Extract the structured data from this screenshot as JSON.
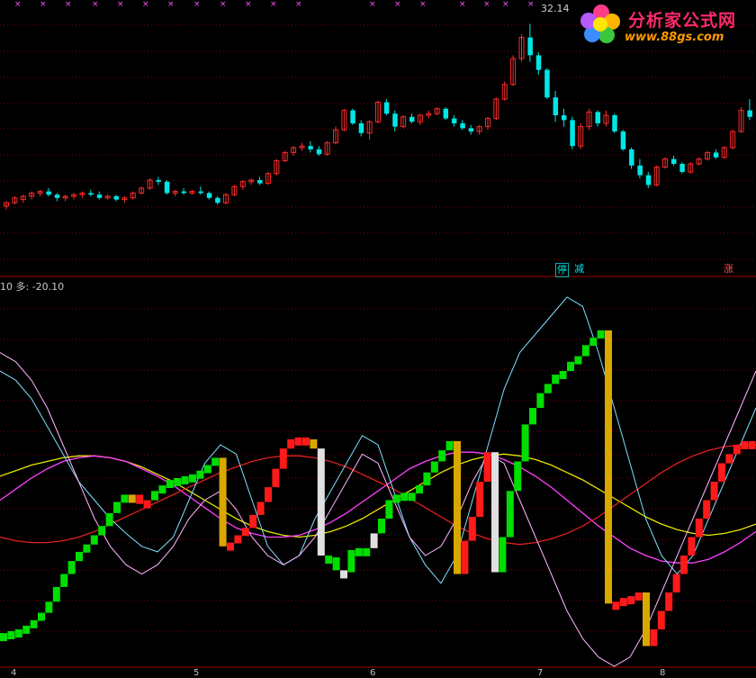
{
  "logo": {
    "title": "分析家公式网",
    "url": "www.88gs.com"
  },
  "price_panel": {
    "high_label": "32.14"
  },
  "indicator_panel": {
    "label": "10 多: -20.10"
  },
  "signals": {
    "stop": "停",
    "cut": "减",
    "up": "涨"
  },
  "date_ticks": [
    "4",
    "5",
    "6",
    "7",
    "8"
  ],
  "colors": {
    "up": "#ff2a2a",
    "down": "#00e6e6",
    "bull_block": "#00dd00",
    "bear_block": "#ff1a1a",
    "grid": "#7a0000",
    "yellow": "#e6e600",
    "magenta": "#ff40ff",
    "red_line": "#e02020",
    "cyan_line": "#7fe0ff",
    "pink_line": "#ffb6ff"
  },
  "chart_data": [
    {
      "type": "candlestick",
      "title": "",
      "candles": [
        [
          20.9,
          21.2,
          20.7,
          21.1
        ],
        [
          21.1,
          21.5,
          21.0,
          21.4
        ],
        [
          21.3,
          21.6,
          21.1,
          21.5
        ],
        [
          21.5,
          21.8,
          21.3,
          21.7
        ],
        [
          21.7,
          21.9,
          21.5,
          21.8
        ],
        [
          21.8,
          22.0,
          21.5,
          21.6
        ],
        [
          21.6,
          21.7,
          21.2,
          21.4
        ],
        [
          21.4,
          21.6,
          21.2,
          21.5
        ],
        [
          21.5,
          21.7,
          21.3,
          21.6
        ],
        [
          21.6,
          21.8,
          21.4,
          21.7
        ],
        [
          21.7,
          21.9,
          21.5,
          21.6
        ],
        [
          21.6,
          21.8,
          21.3,
          21.4
        ],
        [
          21.4,
          21.6,
          21.3,
          21.5
        ],
        [
          21.5,
          21.6,
          21.2,
          21.3
        ],
        [
          21.3,
          21.5,
          21.1,
          21.4
        ],
        [
          21.4,
          21.8,
          21.3,
          21.7
        ],
        [
          21.7,
          22.1,
          21.6,
          22.0
        ],
        [
          22.0,
          22.6,
          21.9,
          22.5
        ],
        [
          22.5,
          22.7,
          22.2,
          22.4
        ],
        [
          22.4,
          22.5,
          21.6,
          21.7
        ],
        [
          21.7,
          21.9,
          21.5,
          21.8
        ],
        [
          21.8,
          22.0,
          21.6,
          21.7
        ],
        [
          21.7,
          21.9,
          21.6,
          21.8
        ],
        [
          21.8,
          22.1,
          21.6,
          21.7
        ],
        [
          21.7,
          21.8,
          21.3,
          21.4
        ],
        [
          21.4,
          21.5,
          21.0,
          21.1
        ],
        [
          21.1,
          21.7,
          21.0,
          21.6
        ],
        [
          21.6,
          22.2,
          21.5,
          22.1
        ],
        [
          22.1,
          22.5,
          21.9,
          22.4
        ],
        [
          22.4,
          22.6,
          22.2,
          22.5
        ],
        [
          22.5,
          22.7,
          22.2,
          22.3
        ],
        [
          22.3,
          23.0,
          22.2,
          22.9
        ],
        [
          22.9,
          23.8,
          22.8,
          23.7
        ],
        [
          23.7,
          24.3,
          23.6,
          24.2
        ],
        [
          24.2,
          24.6,
          24.0,
          24.5
        ],
        [
          24.5,
          24.8,
          24.3,
          24.6
        ],
        [
          24.6,
          24.9,
          24.2,
          24.4
        ],
        [
          24.4,
          24.6,
          24.0,
          24.1
        ],
        [
          24.1,
          24.9,
          24.0,
          24.8
        ],
        [
          24.8,
          25.8,
          24.7,
          25.6
        ],
        [
          25.6,
          26.9,
          25.5,
          26.8
        ],
        [
          26.8,
          26.9,
          25.9,
          26.0
        ],
        [
          26.0,
          26.2,
          25.2,
          25.4
        ],
        [
          25.4,
          26.2,
          25.0,
          26.1
        ],
        [
          26.1,
          27.4,
          26.0,
          27.3
        ],
        [
          27.3,
          27.5,
          26.5,
          26.6
        ],
        [
          26.6,
          26.8,
          25.5,
          25.8
        ],
        [
          25.8,
          26.5,
          25.7,
          26.4
        ],
        [
          26.4,
          26.6,
          26.0,
          26.1
        ],
        [
          26.1,
          26.6,
          25.9,
          26.5
        ],
        [
          26.5,
          26.8,
          26.3,
          26.6
        ],
        [
          26.6,
          27.0,
          26.5,
          26.9
        ],
        [
          26.9,
          27.0,
          26.2,
          26.3
        ],
        [
          26.3,
          26.5,
          25.8,
          26.0
        ],
        [
          26.0,
          26.2,
          25.6,
          25.7
        ],
        [
          25.7,
          25.9,
          25.3,
          25.5
        ],
        [
          25.5,
          25.9,
          25.3,
          25.8
        ],
        [
          25.8,
          26.4,
          25.6,
          26.3
        ],
        [
          26.3,
          27.6,
          26.2,
          27.5
        ],
        [
          27.5,
          28.6,
          27.4,
          28.4
        ],
        [
          28.4,
          30.2,
          28.3,
          30.0
        ],
        [
          30.0,
          31.5,
          29.8,
          31.3
        ],
        [
          31.3,
          32.14,
          29.8,
          30.2
        ],
        [
          30.2,
          30.4,
          29.0,
          29.3
        ],
        [
          29.3,
          29.4,
          27.5,
          27.6
        ],
        [
          27.6,
          28.0,
          26.1,
          26.5
        ],
        [
          26.5,
          26.9,
          25.8,
          26.2
        ],
        [
          26.2,
          26.4,
          24.4,
          24.6
        ],
        [
          24.6,
          26.0,
          24.4,
          25.8
        ],
        [
          25.8,
          26.9,
          25.6,
          26.7
        ],
        [
          26.7,
          26.8,
          25.8,
          26.0
        ],
        [
          26.0,
          26.8,
          25.8,
          26.5
        ],
        [
          26.5,
          26.6,
          25.4,
          25.5
        ],
        [
          25.5,
          25.6,
          24.3,
          24.4
        ],
        [
          24.4,
          24.5,
          23.2,
          23.4
        ],
        [
          23.4,
          23.8,
          22.6,
          22.8
        ],
        [
          22.8,
          23.0,
          22.0,
          22.2
        ],
        [
          22.2,
          23.4,
          22.1,
          23.3
        ],
        [
          23.3,
          23.9,
          23.2,
          23.8
        ],
        [
          23.8,
          24.0,
          23.4,
          23.5
        ],
        [
          23.5,
          23.6,
          22.9,
          23.0
        ],
        [
          23.0,
          23.6,
          22.9,
          23.5
        ],
        [
          23.5,
          23.9,
          23.4,
          23.8
        ],
        [
          23.8,
          24.3,
          23.7,
          24.2
        ],
        [
          24.2,
          24.4,
          23.8,
          23.9
        ],
        [
          23.9,
          24.6,
          23.8,
          24.5
        ],
        [
          24.5,
          25.6,
          24.4,
          25.5
        ],
        [
          25.5,
          27.0,
          25.4,
          26.8
        ],
        [
          26.8,
          27.5,
          26.2,
          26.4
        ]
      ],
      "high_marker": 32.14,
      "signals": [
        {
          "label": "停",
          "index": 76
        },
        {
          "label": "减",
          "index": 78
        },
        {
          "label": "涨",
          "index": 98
        }
      ]
    },
    {
      "type": "line",
      "title": "",
      "value_label": "10 多: -20.10",
      "x_ticks": [
        "4",
        "5",
        "6",
        "7",
        "8"
      ],
      "blocks": [
        [
          -82,
          "g"
        ],
        [
          -81,
          "g"
        ],
        [
          -80,
          "g"
        ],
        [
          -78,
          "g"
        ],
        [
          -75,
          "g"
        ],
        [
          -71,
          "g"
        ],
        [
          -65,
          "g"
        ],
        [
          -57,
          "g"
        ],
        [
          -50,
          "g"
        ],
        [
          -43,
          "g"
        ],
        [
          -38,
          "g"
        ],
        [
          -34,
          "g"
        ],
        [
          -29,
          "g"
        ],
        [
          -24,
          "g"
        ],
        [
          -17,
          "g"
        ],
        [
          -11,
          "g"
        ],
        [
          -7,
          "g"
        ],
        [
          -7,
          "y"
        ],
        [
          -12,
          "r"
        ],
        [
          -10,
          "r"
        ],
        [
          -5,
          "g"
        ],
        [
          -2,
          "g"
        ],
        [
          1,
          "g"
        ],
        [
          2,
          "g"
        ],
        [
          3,
          "g"
        ],
        [
          4,
          "g"
        ],
        [
          6,
          "g"
        ],
        [
          9,
          "g"
        ],
        [
          13,
          "g"
        ],
        [
          -35,
          "y"
        ],
        [
          -33,
          "r"
        ],
        [
          -29,
          "r"
        ],
        [
          -25,
          "r"
        ],
        [
          -18,
          "r"
        ],
        [
          -11,
          "r"
        ],
        [
          -3,
          "r"
        ],
        [
          7,
          "r"
        ],
        [
          18,
          "r"
        ],
        [
          23,
          "r"
        ],
        [
          24,
          "r"
        ],
        [
          23,
          "r"
        ],
        [
          18,
          "y"
        ],
        [
          -40,
          "w"
        ],
        [
          -41,
          "g"
        ],
        [
          -48,
          "g"
        ],
        [
          -49,
          "w"
        ],
        [
          -37,
          "g"
        ],
        [
          -36,
          "g"
        ],
        [
          -36,
          "g"
        ],
        [
          -28,
          "w"
        ],
        [
          -20,
          "g"
        ],
        [
          -10,
          "g"
        ],
        [
          -7,
          "g"
        ],
        [
          -6,
          "g"
        ],
        [
          -6,
          "g"
        ],
        [
          -2,
          "g"
        ],
        [
          5,
          "g"
        ],
        [
          11,
          "g"
        ],
        [
          17,
          "g"
        ],
        [
          22,
          "g"
        ],
        [
          -50,
          "y"
        ],
        [
          -32,
          "r"
        ],
        [
          -19,
          "r"
        ],
        [
          0,
          "r"
        ],
        [
          16,
          "r"
        ],
        [
          -49,
          "w"
        ],
        [
          -30,
          "g"
        ],
        [
          -5,
          "g"
        ],
        [
          11,
          "g"
        ],
        [
          31,
          "g"
        ],
        [
          40,
          "g"
        ],
        [
          48,
          "g"
        ],
        [
          53,
          "g"
        ],
        [
          58,
          "g"
        ],
        [
          60,
          "g"
        ],
        [
          65,
          "g"
        ],
        [
          68,
          "g"
        ],
        [
          74,
          "g"
        ],
        [
          78,
          "g"
        ],
        [
          82,
          "g"
        ],
        [
          -66,
          "y"
        ],
        [
          -65,
          "r"
        ],
        [
          -63,
          "r"
        ],
        [
          -62,
          "r"
        ],
        [
          -60,
          "r"
        ],
        [
          -89,
          "y"
        ],
        [
          -80,
          "r"
        ],
        [
          -70,
          "r"
        ],
        [
          -60,
          "r"
        ],
        [
          -50,
          "r"
        ],
        [
          -40,
          "r"
        ],
        [
          -30,
          "r"
        ],
        [
          -20,
          "r"
        ],
        [
          -10,
          "r"
        ],
        [
          0,
          "r"
        ],
        [
          10,
          "r"
        ],
        [
          15,
          "r"
        ],
        [
          20,
          "r"
        ],
        [
          22,
          "r"
        ],
        [
          20,
          "r"
        ]
      ],
      "series": [
        {
          "color": "yellow",
          "values": [
            3,
            6,
            9,
            11,
            13,
            14,
            14,
            13,
            11,
            8,
            4,
            0,
            -5,
            -10,
            -15,
            -20,
            -24,
            -27,
            -29,
            -30,
            -29,
            -27,
            -24,
            -20,
            -15,
            -10,
            -5,
            0,
            5,
            9,
            12,
            14,
            15,
            14,
            12,
            9,
            5,
            1,
            -4,
            -9,
            -14,
            -19,
            -23,
            -26,
            -28,
            -29,
            -28,
            -26,
            -23
          ]
        },
        {
          "color": "magenta",
          "values": [
            -10,
            -4,
            2,
            7,
            11,
            13,
            14,
            13,
            11,
            7,
            3,
            -2,
            -8,
            -14,
            -20,
            -25,
            -28,
            -30,
            -30,
            -29,
            -26,
            -22,
            -17,
            -11,
            -5,
            1,
            7,
            11,
            14,
            16,
            16,
            15,
            12,
            8,
            3,
            -3,
            -10,
            -17,
            -24,
            -30,
            -36,
            -40,
            -43,
            -44,
            -44,
            -42,
            -38,
            -33,
            -27
          ]
        },
        {
          "color": "red_line",
          "values": [
            -30,
            -32,
            -33,
            -33,
            -32,
            -30,
            -27,
            -23,
            -19,
            -15,
            -11,
            -7,
            -3,
            1,
            5,
            8,
            11,
            13,
            14,
            14,
            13,
            11,
            8,
            4,
            0,
            -4,
            -9,
            -14,
            -19,
            -24,
            -28,
            -31,
            -33,
            -34,
            -33,
            -31,
            -28,
            -24,
            -19,
            -13,
            -7,
            -1,
            5,
            10,
            14,
            17,
            19,
            20,
            20
          ]
        }
      ],
      "thin_lines": [
        {
          "color": "cyan_line",
          "values": [
            60,
            55,
            45,
            30,
            15,
            0,
            -10,
            -20,
            -28,
            -35,
            -38,
            -30,
            -10,
            10,
            20,
            15,
            -10,
            -35,
            -45,
            -40,
            -20,
            -5,
            10,
            25,
            20,
            -5,
            -30,
            -45,
            -55,
            -40,
            -10,
            20,
            50,
            70,
            80,
            90,
            100,
            95,
            70,
            40,
            10,
            -20,
            -40,
            -50,
            -40,
            -20,
            0,
            20,
            40
          ]
        },
        {
          "color": "pink_line",
          "values": [
            70,
            65,
            55,
            40,
            20,
            0,
            -20,
            -35,
            -45,
            -50,
            -45,
            -35,
            -20,
            -10,
            -5,
            -15,
            -30,
            -40,
            -45,
            -40,
            -30,
            -15,
            0,
            15,
            10,
            -10,
            -30,
            -40,
            -35,
            -20,
            0,
            15,
            10,
            -10,
            -30,
            -50,
            -70,
            -85,
            -95,
            -100,
            -95,
            -80,
            -60,
            -40,
            -20,
            0,
            20,
            40,
            60
          ]
        }
      ],
      "ylim": [
        -100,
        100
      ]
    }
  ]
}
